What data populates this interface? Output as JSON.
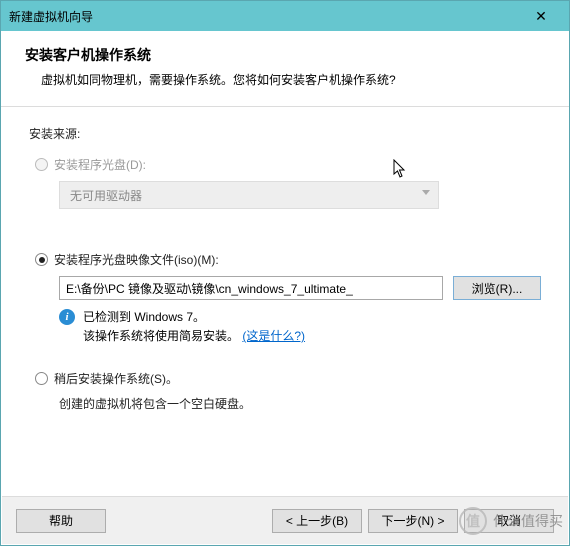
{
  "window": {
    "title": "新建虚拟机向导",
    "close_glyph": "✕"
  },
  "header": {
    "heading": "安装客户机操作系统",
    "subheading": "虚拟机如同物理机，需要操作系统。您将如何安装客户机操作系统?"
  },
  "source": {
    "label": "安装来源:",
    "opt_disc": {
      "label": "安装程序光盘(D):"
    },
    "drive_combo": {
      "text": "无可用驱动器"
    },
    "opt_iso": {
      "label": "安装程序光盘映像文件(iso)(M):"
    },
    "iso_path": "E:\\备份\\PC 镜像及驱动\\镜像\\cn_windows_7_ultimate_",
    "browse_label": "浏览(R)...",
    "detect_line1": "已检测到 Windows 7。",
    "detect_line2_prefix": "该操作系统将使用简易安装。",
    "detect_link": "(这是什么?)",
    "opt_later": {
      "label": "稍后安装操作系统(S)。"
    },
    "later_hint": "创建的虚拟机将包含一个空白硬盘。"
  },
  "footer": {
    "help": "帮助",
    "back": "< 上一步(B)",
    "next": "下一步(N) >",
    "cancel": "取消"
  },
  "watermark": {
    "logo": "值",
    "text": "什么值得买"
  }
}
